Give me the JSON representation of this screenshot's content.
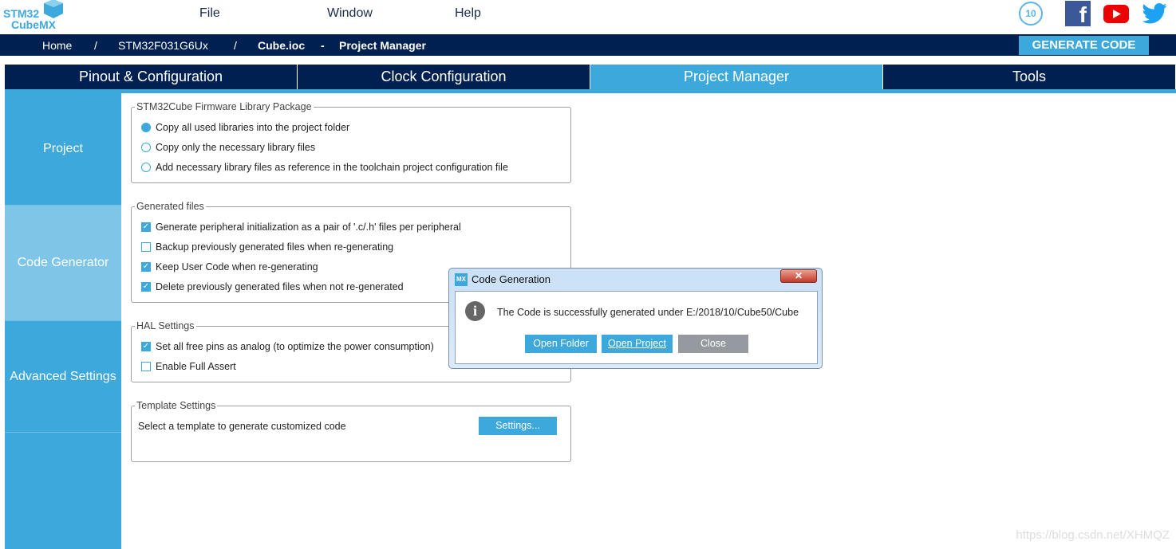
{
  "logo": {
    "line1": "STM32",
    "line2": "CubeMX"
  },
  "menu": [
    "File",
    "Window",
    "Help"
  ],
  "social": [
    "anniversary-10-years-icon",
    "facebook-icon",
    "youtube-icon",
    "twitter-icon"
  ],
  "breadcrumb": {
    "home": "Home",
    "sep": "/",
    "device": "STM32F031G6Ux",
    "file": "Cube.ioc",
    "dash": "-",
    "page": "Project Manager"
  },
  "generate_label": "GENERATE CODE",
  "tabs": [
    {
      "label": "Pinout & Configuration"
    },
    {
      "label": "Clock Configuration"
    },
    {
      "label": "Project Manager",
      "active": true
    },
    {
      "label": "Tools"
    }
  ],
  "sidebar": [
    {
      "label": "Project"
    },
    {
      "label": "Code Generator",
      "active": true
    },
    {
      "label": "Advanced Settings"
    }
  ],
  "firmware": {
    "legend": "STM32Cube Firmware Library Package",
    "options": [
      {
        "label": "Copy all used libraries into the project folder",
        "selected": true
      },
      {
        "label": "Copy only the necessary library files",
        "selected": false
      },
      {
        "label": "Add necessary library files as reference in the toolchain project configuration file",
        "selected": false
      }
    ]
  },
  "generated": {
    "legend": "Generated files",
    "options": [
      {
        "label": "Generate peripheral initialization as a pair of '.c/.h' files per peripheral",
        "checked": true
      },
      {
        "label": "Backup previously generated files when re-generating",
        "checked": false
      },
      {
        "label": "Keep User Code when re-generating",
        "checked": true
      },
      {
        "label": "Delete previously generated files when not re-generated",
        "checked": true
      }
    ]
  },
  "hal": {
    "legend": "HAL Settings",
    "options": [
      {
        "label": "Set all free pins as analog (to optimize the power consumption)",
        "checked": true
      },
      {
        "label": "Enable Full Assert",
        "checked": false
      }
    ]
  },
  "template": {
    "legend": "Template Settings",
    "text": "Select a template to generate customized code",
    "button": "Settings..."
  },
  "dialog": {
    "icon": "MX",
    "title": "Code Generation",
    "close": "✕",
    "message": "The Code is successfully generated under E:/2018/10/Cube50/Cube",
    "buttons": {
      "open_folder": "Open Folder",
      "open_project": "Open Project",
      "close": "Close"
    }
  },
  "watermark": "https://blog.csdn.net/XHMQZ",
  "colors": {
    "navy": "#002052",
    "accent": "#3ca8dc",
    "close_btn": "#949aa0"
  }
}
